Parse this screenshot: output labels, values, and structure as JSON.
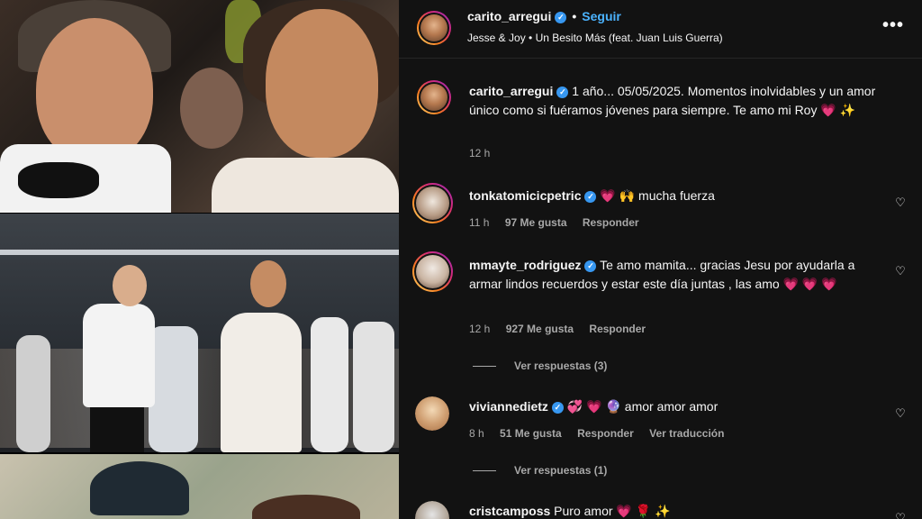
{
  "post": {
    "author": "carito_arregui",
    "follow_label": "Seguir",
    "separator": "•",
    "song": "Jesse & Joy • Un Besito Más (feat. Juan Luis Guerra)",
    "more_label": "•••"
  },
  "caption": {
    "username": "carito_arregui",
    "text": "1 año... 05/05/2025. Momentos inolvidables y un amor único como si fuéramos jóvenes para siempre. Te amo mi Roy",
    "emojis": "💗 ✨",
    "time": "12 h"
  },
  "comments": [
    {
      "username": "tonkatomicicpetric",
      "text": "mucha fuerza",
      "emojis_prefix": "💗 🙌",
      "time": "11 h",
      "likes": "97 Me gusta",
      "reply_label": "Responder"
    },
    {
      "username": "mmayte_rodriguez",
      "text": "Te amo mamita... gracias Jesu por ayudarla a armar lindos recuerdos y estar este día juntas , las amo",
      "emojis_suffix": "💗 💗 💗",
      "time": "12 h",
      "likes": "927 Me gusta",
      "reply_label": "Responder",
      "view_replies": "Ver respuestas (3)"
    },
    {
      "username": "viviannedietz",
      "text": "amor amor amor",
      "emojis_prefix": "💞 💗 🔮",
      "time": "8 h",
      "likes": "51 Me gusta",
      "reply_label": "Responder",
      "translate_label": "Ver traducción",
      "view_replies": "Ver respuestas (1)"
    },
    {
      "username": "cristcamposs",
      "text": "Puro amor",
      "emojis_suffix": "💗 🌹 ✨"
    }
  ],
  "icons": {
    "verified": "verified-badge-icon",
    "like": "heart-outline-icon",
    "more": "more-options-icon"
  },
  "colors": {
    "panel_bg": "#121212",
    "verified": "#3797f0",
    "follow": "#4bb3ff",
    "muted": "#a8a8a8",
    "heart": "#ff3c7d"
  }
}
